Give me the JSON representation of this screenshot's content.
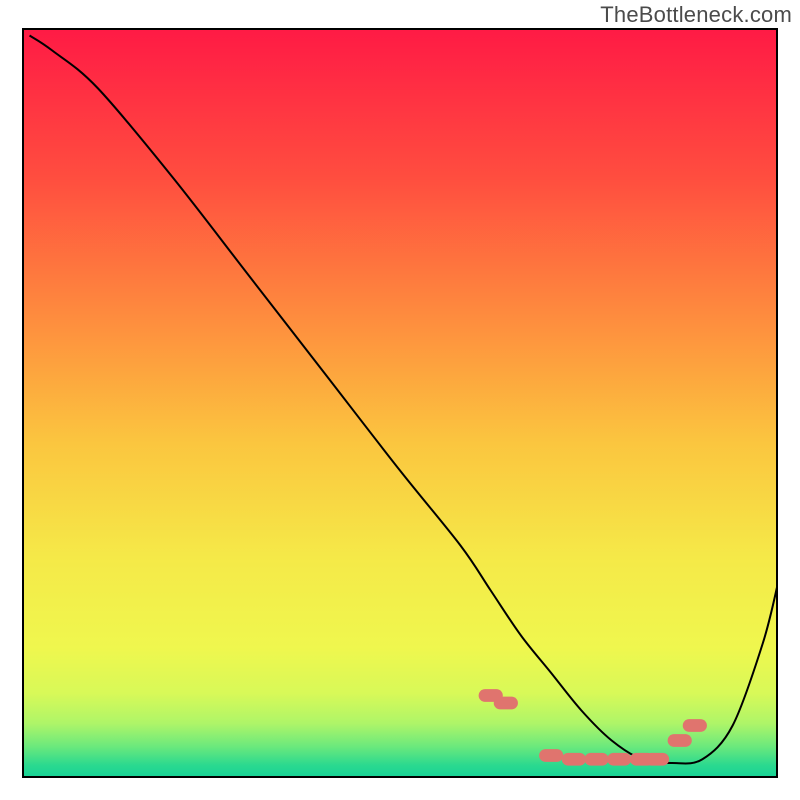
{
  "watermark": "TheBottleneck.com",
  "chart_data": {
    "type": "line",
    "title": "",
    "xlabel": "",
    "ylabel": "",
    "xlim": [
      0,
      100
    ],
    "ylim": [
      0,
      100
    ],
    "grid": false,
    "legend": false,
    "series": [
      {
        "name": "curve",
        "x": [
          1,
          4,
          10,
          20,
          30,
          40,
          50,
          58,
          62,
          66,
          70,
          74,
          78,
          82,
          86,
          90,
          94,
          98,
          100
        ],
        "y": [
          99,
          97,
          92,
          80,
          67,
          54,
          41,
          31,
          25,
          19,
          14,
          9,
          5,
          2.5,
          2,
          2.5,
          7,
          18,
          26
        ],
        "mode": "line",
        "color": "#000000"
      },
      {
        "name": "data-points",
        "x": [
          62,
          64,
          70,
          73,
          76,
          79,
          82,
          84,
          87,
          89
        ],
        "y": [
          11,
          10,
          3,
          2.5,
          2.5,
          2.5,
          2.5,
          2.5,
          5,
          7
        ],
        "mode": "markers",
        "color": "#e0746e"
      }
    ],
    "background_gradient": {
      "stops": [
        {
          "offset": 0.0,
          "color": "#ff1a45"
        },
        {
          "offset": 0.2,
          "color": "#ff4e3f"
        },
        {
          "offset": 0.4,
          "color": "#fe923e"
        },
        {
          "offset": 0.55,
          "color": "#fbc63f"
        },
        {
          "offset": 0.7,
          "color": "#f5e948"
        },
        {
          "offset": 0.82,
          "color": "#eff74e"
        },
        {
          "offset": 0.88,
          "color": "#d8f958"
        },
        {
          "offset": 0.92,
          "color": "#aef568"
        },
        {
          "offset": 0.95,
          "color": "#6ce97c"
        },
        {
          "offset": 0.975,
          "color": "#2bd98f"
        },
        {
          "offset": 1.0,
          "color": "#0bcf9a"
        }
      ]
    }
  }
}
